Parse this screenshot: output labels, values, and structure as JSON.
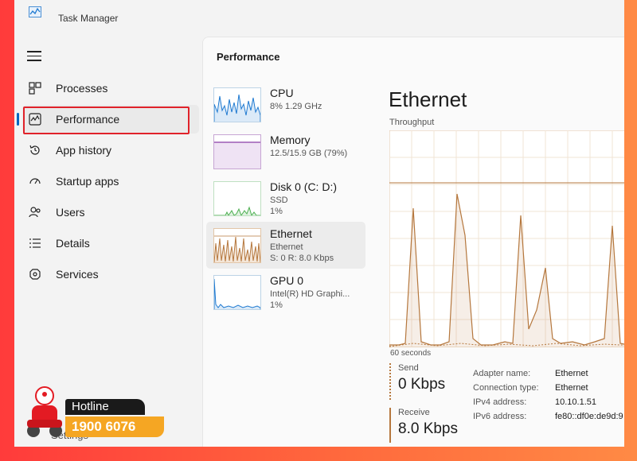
{
  "app": {
    "title": "Task Manager"
  },
  "nav": {
    "items": [
      {
        "label": "Processes",
        "icon": "processes-icon"
      },
      {
        "label": "Performance",
        "icon": "performance-icon"
      },
      {
        "label": "App history",
        "icon": "history-icon"
      },
      {
        "label": "Startup apps",
        "icon": "startup-icon"
      },
      {
        "label": "Users",
        "icon": "users-icon"
      },
      {
        "label": "Details",
        "icon": "details-icon"
      },
      {
        "label": "Services",
        "icon": "services-icon"
      }
    ],
    "active": "Performance",
    "settings_label": "Settings"
  },
  "panel": {
    "title": "Performance"
  },
  "resources": [
    {
      "name": "CPU",
      "line1": "8%  1.29 GHz",
      "line2": "",
      "color": "#1f7ad1"
    },
    {
      "name": "Memory",
      "line1": "12.5/15.9 GB (79%)",
      "line2": "",
      "color": "#8b3fa8"
    },
    {
      "name": "Disk 0 (C: D:)",
      "line1": "SSD",
      "line2": "1%",
      "color": "#4caf50"
    },
    {
      "name": "Ethernet",
      "line1": "Ethernet",
      "line2": "S: 0  R: 8.0 Kbps",
      "color": "#b5773d"
    },
    {
      "name": "GPU 0",
      "line1": "Intel(R) HD Graphi...",
      "line2": "1%",
      "color": "#1f7ad1"
    }
  ],
  "detail": {
    "title": "Ethernet",
    "chart_label": "Throughput",
    "time_label": "60 seconds",
    "send_label": "Send",
    "send_value": "0 Kbps",
    "receive_label": "Receive",
    "receive_value": "8.0 Kbps",
    "properties": [
      {
        "key": "Adapter name:",
        "value": "Ethernet"
      },
      {
        "key": "Connection type:",
        "value": "Ethernet"
      },
      {
        "key": "IPv4 address:",
        "value": "10.10.1.51"
      },
      {
        "key": "IPv6 address:",
        "value": "fe80::df0e:de9d:9"
      }
    ]
  },
  "hotline": {
    "label": "Hotline",
    "number": "1900 6076"
  },
  "colors": {
    "accent": "#0067c0",
    "ethernet": "#b5773d",
    "highlight": "#e0222a"
  }
}
